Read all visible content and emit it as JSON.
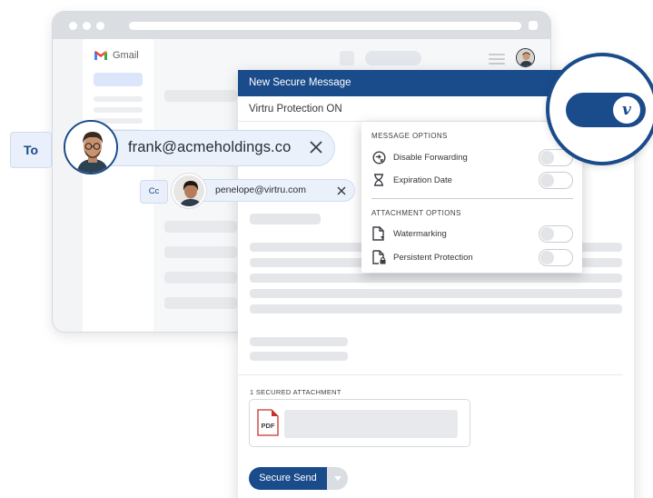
{
  "gmail": {
    "app_name": "Gmail"
  },
  "compose": {
    "title": "New Secure Message",
    "protection_status": "Virtru Protection ON",
    "attachments_label": "1 SECURED ATTACHMENT",
    "attachment_type": "PDF",
    "send_label": "Secure Send"
  },
  "options": {
    "message_heading": "MESSAGE OPTIONS",
    "message_items": [
      {
        "label": "Disable Forwarding",
        "icon": "disable-forwarding-icon",
        "enabled": false
      },
      {
        "label": "Expiration Date",
        "icon": "hourglass-icon",
        "enabled": false
      }
    ],
    "attachment_heading": "ATTACHMENT OPTIONS",
    "attachment_items": [
      {
        "label": "Watermarking",
        "icon": "watermark-file-icon",
        "enabled": false
      },
      {
        "label": "Persistent Protection",
        "icon": "locked-file-icon",
        "enabled": false
      }
    ]
  },
  "recipients": {
    "to_label": "To",
    "to_email": "frank@acmeholdings.co",
    "cc_label": "Cc",
    "cc_email": "penelope@virtru.com"
  },
  "badge": {
    "glyph": "v",
    "state": "on"
  },
  "colors": {
    "brand": "#1a4b8a",
    "chip_bg": "#eaf1fb",
    "pdf_red": "#c5322d"
  }
}
